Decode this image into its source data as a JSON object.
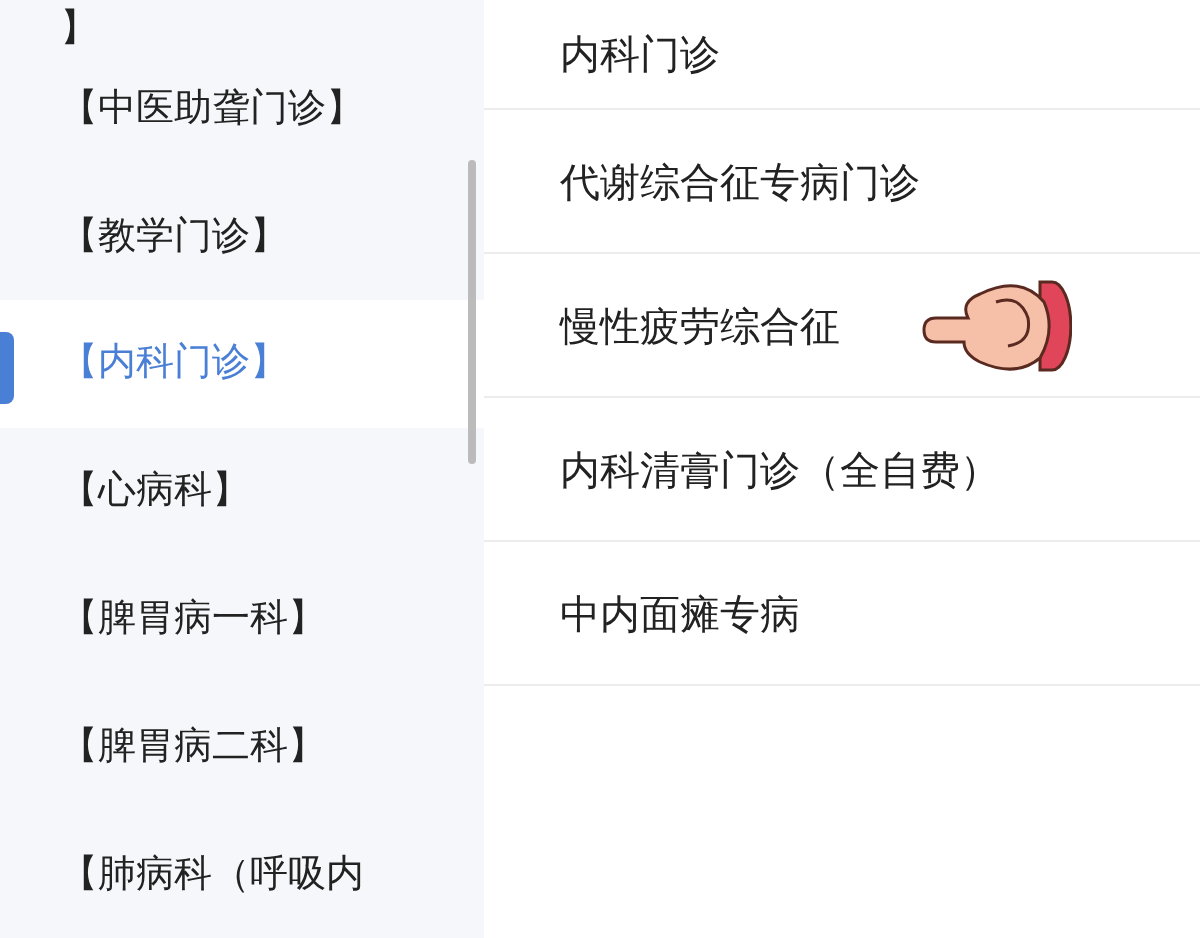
{
  "sidebar": {
    "items": [
      {
        "label": "】",
        "selected": false
      },
      {
        "label": "【中医助聋门诊】",
        "selected": false
      },
      {
        "label": "【教学门诊】",
        "selected": false
      },
      {
        "label": "【内科门诊】",
        "selected": true
      },
      {
        "label": "【心病科】",
        "selected": false
      },
      {
        "label": "【脾胃病一科】",
        "selected": false
      },
      {
        "label": "【脾胃病二科】",
        "selected": false
      },
      {
        "label": "【肺病科（呼吸内",
        "selected": false
      }
    ]
  },
  "list": {
    "items": [
      {
        "label": "内科门诊",
        "pointer": false
      },
      {
        "label": "代谢综合征专病门诊",
        "pointer": false
      },
      {
        "label": "慢性疲劳综合征",
        "pointer": true
      },
      {
        "label": "内科清膏门诊（全自费）",
        "pointer": false
      },
      {
        "label": "中内面瘫专病",
        "pointer": false
      }
    ]
  }
}
